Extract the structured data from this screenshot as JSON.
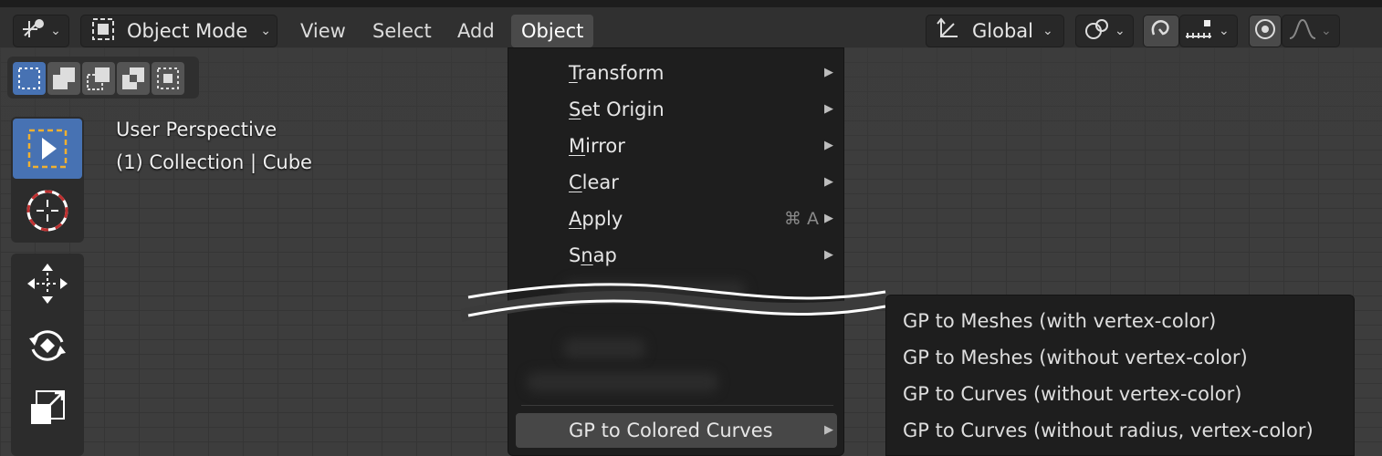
{
  "header": {
    "mode_label": "Object Mode",
    "menus": [
      "View",
      "Select",
      "Add",
      "Object"
    ],
    "orientation_label": "Global"
  },
  "viewport": {
    "perspective_label": "User Perspective",
    "collection_label": "(1) Collection | Cube"
  },
  "object_menu": {
    "items": [
      {
        "label": "Transform",
        "underline": "T"
      },
      {
        "label": "Set Origin",
        "underline": "S"
      },
      {
        "label": "Mirror",
        "underline": "M"
      },
      {
        "label": "Clear",
        "underline": "C"
      },
      {
        "label": "Apply",
        "underline": "A",
        "shortcut": "⌘ A"
      },
      {
        "label": "Snap",
        "underline": "n"
      }
    ],
    "highlighted_item": "GP to Colored Curves"
  },
  "submenu": {
    "items": [
      "GP to Meshes (with vertex-color)",
      "GP to Meshes (without vertex-color)",
      "GP to Curves (without vertex-color)",
      "GP to Curves (without radius, vertex-color)"
    ]
  },
  "colors": {
    "accent": "#4772b3",
    "menu_bg": "#1e1e1e",
    "header_bg": "#303030",
    "viewport_bg": "#3d3d3d"
  },
  "icons": [
    "editor-type-icon",
    "object-mode-icon",
    "transform-orientation-icon",
    "pivot-icon",
    "snap-icon",
    "snap-increment-icon",
    "proportional-edit-icon",
    "falloff-icon",
    "select-box-icon",
    "cursor-icon",
    "move-icon",
    "rotate-icon",
    "scale-icon"
  ]
}
